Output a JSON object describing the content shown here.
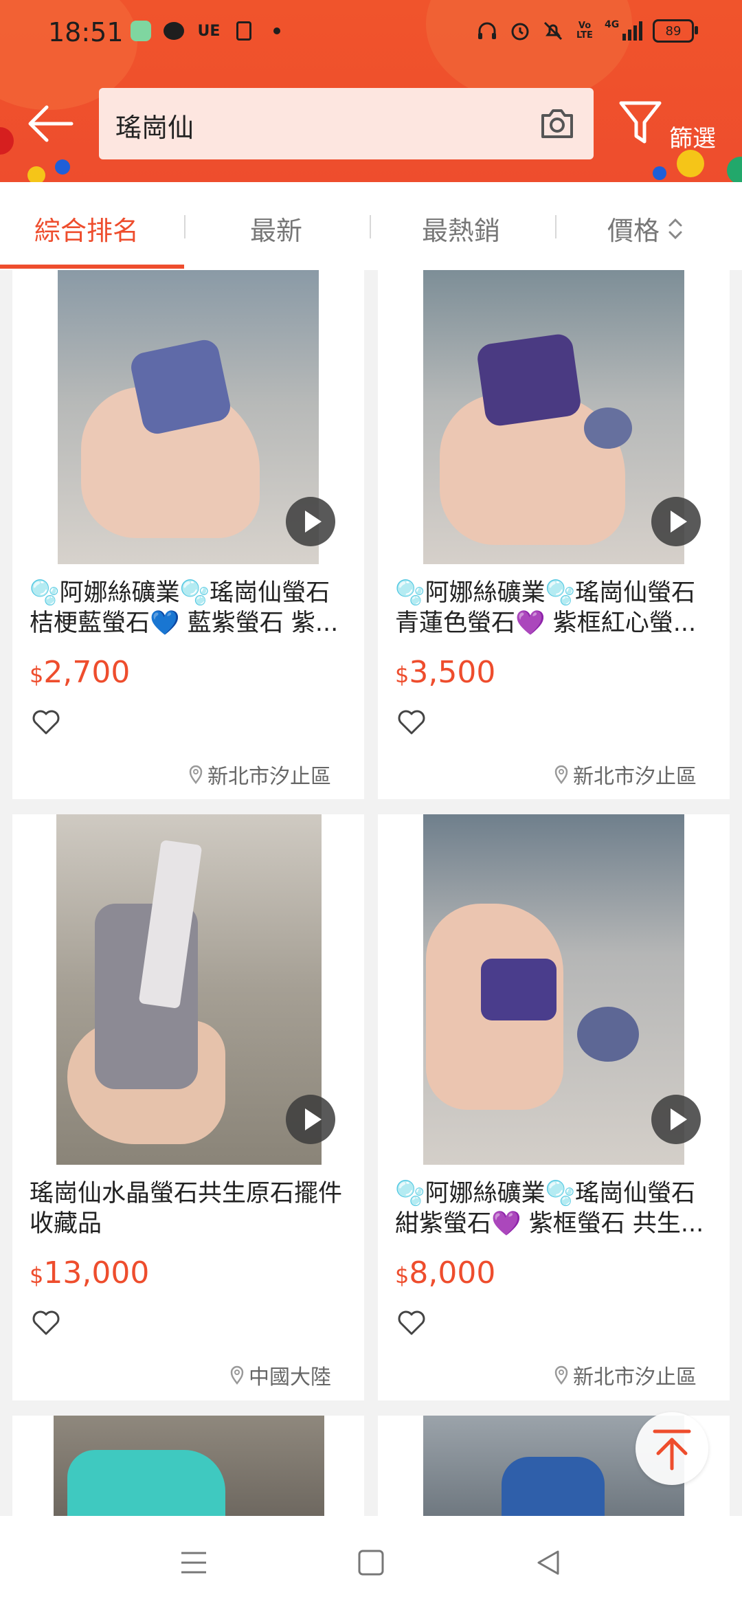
{
  "status_bar": {
    "time": "18:51",
    "left_icons": [
      "app-icon",
      "chat-icon",
      "ue-label",
      "sim-icon",
      "dot-icon"
    ],
    "ue_label": "UE",
    "right_icons": [
      "headphones-icon",
      "alarm-icon",
      "mute-icon",
      "volte-icon",
      "signal-icon"
    ],
    "volte": "Vo LTE",
    "network": "4G",
    "battery": "89"
  },
  "header": {
    "search_query": "瑤崗仙",
    "filter_label": "篩選"
  },
  "sort_tabs": [
    {
      "label": "綜合排名",
      "active": true
    },
    {
      "label": "最新",
      "active": false
    },
    {
      "label": "最熱銷",
      "active": false
    },
    {
      "label": "價格",
      "active": false
    }
  ],
  "products": [
    {
      "title": "🫧阿娜絲礦業🫧瑤崗仙螢石 桔梗藍螢石💙 藍紫螢石 紫...",
      "currency": "$",
      "price": "2,700",
      "location": "新北市汐止區"
    },
    {
      "title": "🫧阿娜絲礦業🫧瑤崗仙螢石 青蓮色螢石💜 紫框紅心螢...",
      "currency": "$",
      "price": "3,500",
      "location": "新北市汐止區"
    },
    {
      "title": " 瑤崗仙水晶螢石共生原石擺件收藏品",
      "currency": "$",
      "price": "13,000",
      "location": "中國大陸"
    },
    {
      "title": "🫧阿娜絲礦業🫧瑤崗仙螢石 紺紫螢石💜 紫框螢石 共生...",
      "currency": "$",
      "price": "8,000",
      "location": "新北市汐止區"
    }
  ],
  "colors": {
    "brand": "#ee4d2d",
    "search_bg": "#fde6e0"
  }
}
